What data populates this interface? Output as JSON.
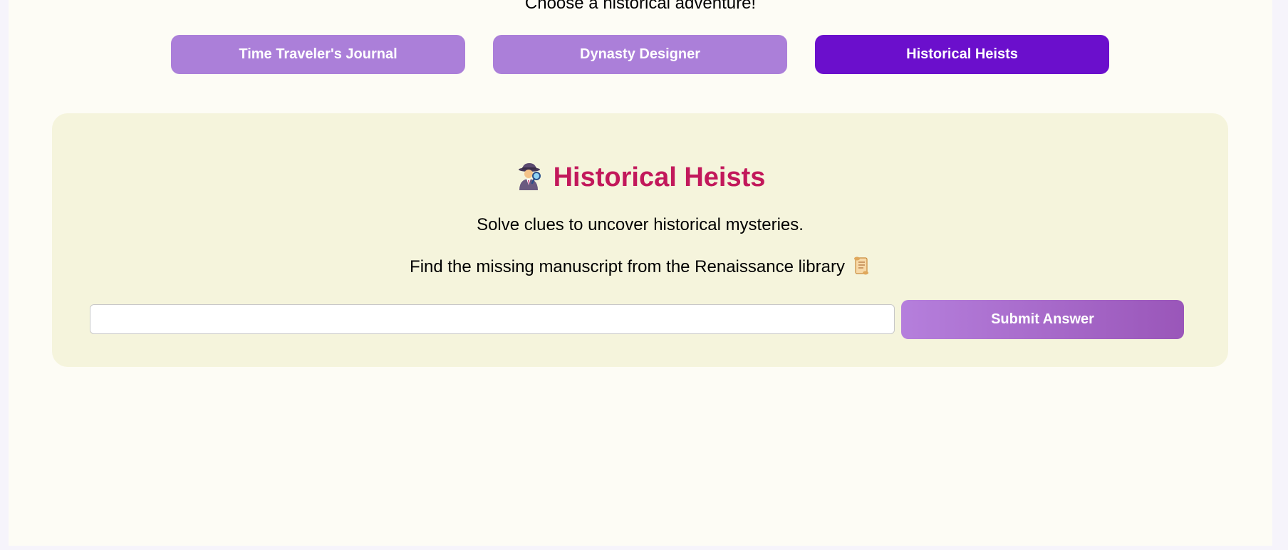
{
  "intro": {
    "text": "Choose a historical adventure!"
  },
  "tabs": [
    {
      "label": "Time Traveler's Journal",
      "active": false
    },
    {
      "label": "Dynasty Designer",
      "active": false
    },
    {
      "label": "Historical Heists",
      "active": true
    }
  ],
  "game": {
    "title": "Historical Heists",
    "title_icon": "detective-icon",
    "description": "Solve clues to uncover historical mysteries.",
    "clue": "Find the missing manuscript from the Renaissance library",
    "clue_icon": "scroll-icon",
    "answer": {
      "value": "",
      "placeholder": ""
    },
    "submit_label": "Submit Answer"
  },
  "colors": {
    "accent_active": "#6b0fcc",
    "accent_inactive": "#ab7fd9",
    "heading": "#c2185b",
    "card_bg": "#f5f4dc",
    "page_bg": "#fdfcf5"
  }
}
